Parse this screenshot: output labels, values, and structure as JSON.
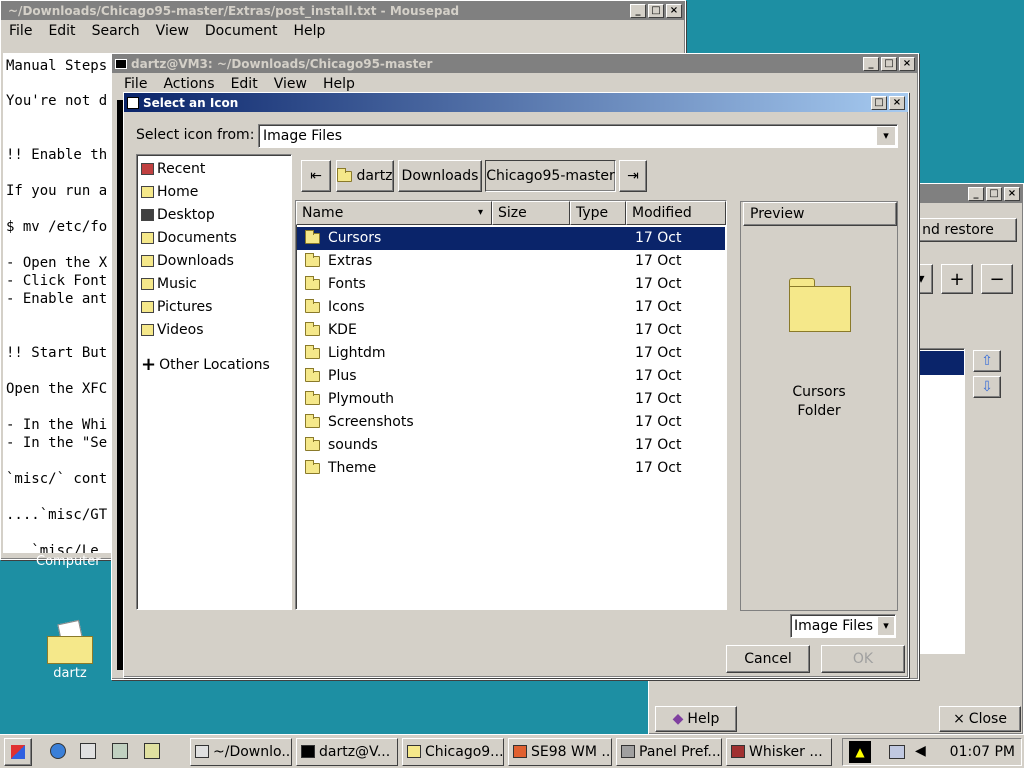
{
  "mousepad": {
    "title": "~/Downloads/Chicago95-master/Extras/post_install.txt - Mousepad",
    "menu": [
      "File",
      "Edit",
      "Search",
      "View",
      "Document",
      "Help"
    ],
    "lines": [
      "Manual Steps",
      "You're not d",
      "!! Enable th",
      "If you run a",
      "$ mv /etc/fo",
      "- Open the X",
      "- Click Font",
      "- Enable ant",
      "!! Start But",
      "Open the XFC",
      "- In the Whi",
      "- In the \"Se",
      "`misc/` cont",
      "....`misc/GT",
      "   `misc/Le"
    ]
  },
  "terminal": {
    "title": "dartz@VM3: ~/Downloads/Chicago95-master",
    "menu": [
      "File",
      "Actions",
      "Edit",
      "View",
      "Help"
    ]
  },
  "panel_window": {
    "restore_label": "nd restore",
    "add": "+",
    "remove": "−",
    "up": "⇧",
    "down": "⇩",
    "help": "Help",
    "close": "Close"
  },
  "dialog": {
    "title": "Select an Icon",
    "select_from_label": "Select icon from:",
    "select_from_value": "Image Files",
    "places": [
      {
        "label": "Recent",
        "color": "#c04040"
      },
      {
        "label": "Home",
        "color": "#f5e88a"
      },
      {
        "label": "Desktop",
        "color": "#404040"
      },
      {
        "label": "Documents",
        "color": "#f5e88a"
      },
      {
        "label": "Downloads",
        "color": "#f5e88a"
      },
      {
        "label": "Music",
        "color": "#f5e88a"
      },
      {
        "label": "Pictures",
        "color": "#f5e88a"
      },
      {
        "label": "Videos",
        "color": "#f5e88a"
      }
    ],
    "other_locations": "Other Locations",
    "path": [
      "dartz",
      "Downloads",
      "Chicago95-master"
    ],
    "columns": {
      "name": "Name",
      "size": "Size",
      "type": "Type",
      "modified": "Modified"
    },
    "files": [
      {
        "name": "Cursors",
        "modified": "17 Oct"
      },
      {
        "name": "Extras",
        "modified": "17 Oct"
      },
      {
        "name": "Fonts",
        "modified": "17 Oct"
      },
      {
        "name": "Icons",
        "modified": "17 Oct"
      },
      {
        "name": "KDE",
        "modified": "17 Oct"
      },
      {
        "name": "Lightdm",
        "modified": "17 Oct"
      },
      {
        "name": "Plus",
        "modified": "17 Oct"
      },
      {
        "name": "Plymouth",
        "modified": "17 Oct"
      },
      {
        "name": "Screenshots",
        "modified": "17 Oct"
      },
      {
        "name": "sounds",
        "modified": "17 Oct"
      },
      {
        "name": "Theme",
        "modified": "17 Oct"
      }
    ],
    "preview_label": "Preview",
    "preview_name": "Cursors",
    "preview_type": "Folder",
    "filter_value": "Image Files",
    "cancel": "Cancel",
    "ok": "OK"
  },
  "desktop": {
    "computer_label": "Computer",
    "dartz_label": "dartz"
  },
  "taskbar": {
    "tasks": [
      {
        "label": "~/Downlo...",
        "color": "#e0e0e0"
      },
      {
        "label": "dartz@V...",
        "color": "#000000"
      },
      {
        "label": "Chicago9...",
        "color": "#f5e88a"
      },
      {
        "label": "SE98 WM ...",
        "color": "#e06030"
      },
      {
        "label": "Panel Pref...",
        "color": "#a0a0a0"
      },
      {
        "label": "Whisker ...",
        "color": "#a03030"
      }
    ],
    "clock": "01:07 PM"
  }
}
